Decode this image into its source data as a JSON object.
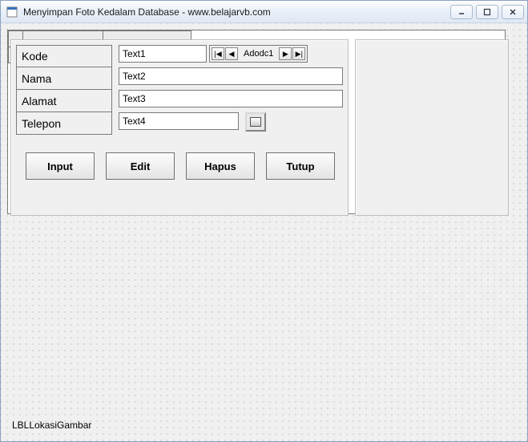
{
  "titlebar": {
    "title": "Menyimpan Foto Kedalam Database - www.belajarvb.com"
  },
  "fields": {
    "kode": {
      "label": "Kode",
      "value": "Text1"
    },
    "nama": {
      "label": "Nama",
      "value": "Text2"
    },
    "alamat": {
      "label": "Alamat",
      "value": "Text3"
    },
    "telepon": {
      "label": "Telepon",
      "value": "Text4"
    }
  },
  "adodc": {
    "caption": "Adodc1",
    "first": "|◀",
    "prev": "◀",
    "next": "▶",
    "last": "▶|"
  },
  "buttons": {
    "input": "Input",
    "edit": "Edit",
    "hapus": "Hapus",
    "tutup": "Tutup"
  },
  "bottom_label": "LBLLokasiGambar"
}
